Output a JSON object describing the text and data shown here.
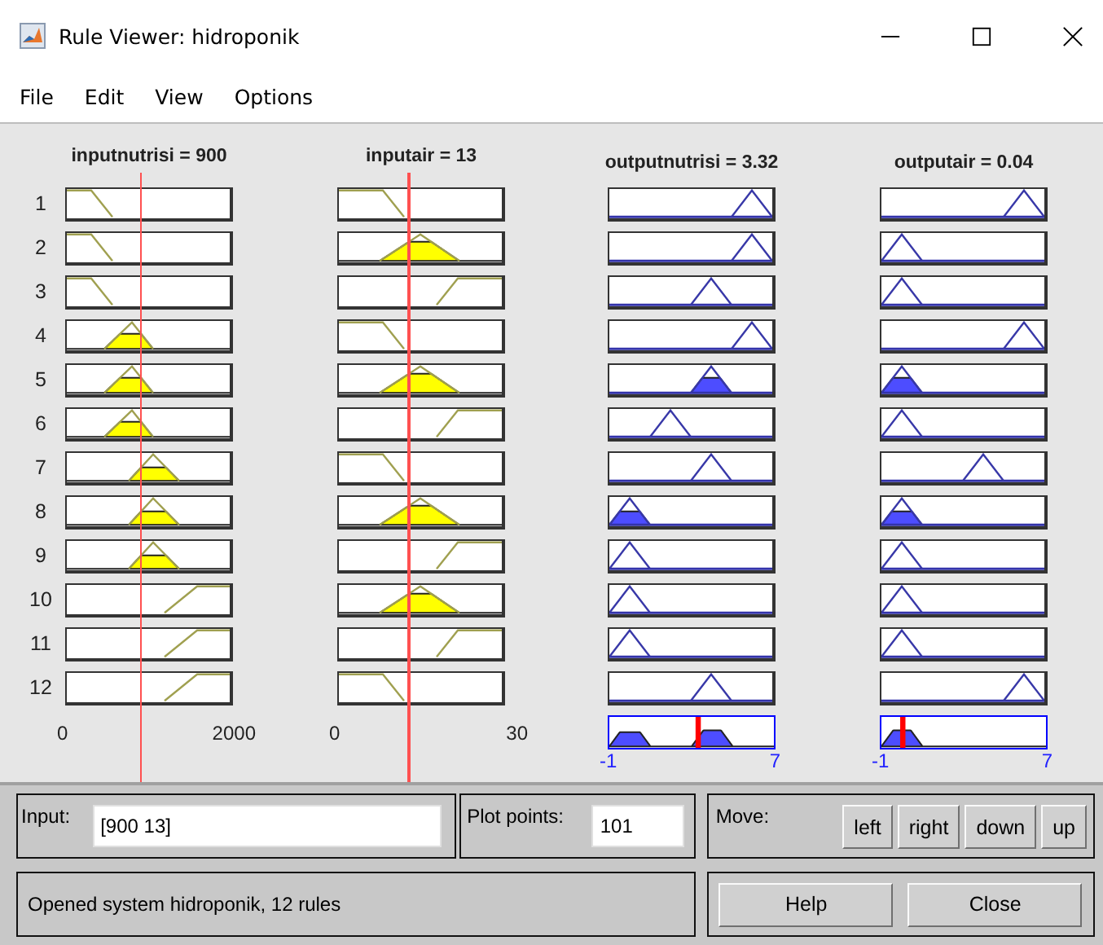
{
  "window": {
    "title": "Rule Viewer: hidroponik"
  },
  "menu": [
    "File",
    "Edit",
    "View",
    "Options"
  ],
  "variables": [
    {
      "title": "inputnutrisi = 900",
      "kind": "input",
      "axis": [
        "0",
        "2000"
      ]
    },
    {
      "title": "inputair = 13",
      "kind": "input",
      "axis": [
        "0",
        "30"
      ]
    },
    {
      "title": "outputnutrisi = 3.32",
      "kind": "output",
      "axis": [
        "-1",
        "7"
      ]
    },
    {
      "title": "outputair = 0.04",
      "kind": "output",
      "axis": [
        "-1",
        "7"
      ]
    }
  ],
  "rules": [
    {
      "label": "1",
      "cells": [
        {
          "kind": "z"
        },
        {
          "kind": "z"
        },
        {
          "kind": "high"
        },
        {
          "kind": "high"
        }
      ]
    },
    {
      "label": "2",
      "cells": [
        {
          "kind": "z"
        },
        {
          "kind": "tri"
        },
        {
          "kind": "high"
        },
        {
          "kind": "low"
        }
      ]
    },
    {
      "label": "3",
      "cells": [
        {
          "kind": "z"
        },
        {
          "kind": "s"
        },
        {
          "kind": "mid"
        },
        {
          "kind": "low"
        }
      ]
    },
    {
      "label": "4",
      "cells": [
        {
          "kind": "tri-a"
        },
        {
          "kind": "z"
        },
        {
          "kind": "high"
        },
        {
          "kind": "high"
        }
      ]
    },
    {
      "label": "5",
      "cells": [
        {
          "kind": "tri-a"
        },
        {
          "kind": "tri"
        },
        {
          "kind": "mid"
        },
        {
          "kind": "low"
        }
      ]
    },
    {
      "label": "6",
      "cells": [
        {
          "kind": "tri-a"
        },
        {
          "kind": "s"
        },
        {
          "kind": "mid-low"
        },
        {
          "kind": "low"
        }
      ]
    },
    {
      "label": "7",
      "cells": [
        {
          "kind": "tri-b"
        },
        {
          "kind": "z"
        },
        {
          "kind": "mid"
        },
        {
          "kind": "mid"
        }
      ]
    },
    {
      "label": "8",
      "cells": [
        {
          "kind": "tri-b"
        },
        {
          "kind": "tri"
        },
        {
          "kind": "low"
        },
        {
          "kind": "low"
        }
      ]
    },
    {
      "label": "9",
      "cells": [
        {
          "kind": "tri-b"
        },
        {
          "kind": "s"
        },
        {
          "kind": "low"
        },
        {
          "kind": "low"
        }
      ]
    },
    {
      "label": "10",
      "cells": [
        {
          "kind": "s"
        },
        {
          "kind": "tri"
        },
        {
          "kind": "low"
        },
        {
          "kind": "low"
        }
      ]
    },
    {
      "label": "11",
      "cells": [
        {
          "kind": "s"
        },
        {
          "kind": "s"
        },
        {
          "kind": "low"
        },
        {
          "kind": "low"
        }
      ]
    },
    {
      "label": "12",
      "cells": [
        {
          "kind": "s"
        },
        {
          "kind": "z"
        },
        {
          "kind": "mid"
        },
        {
          "kind": "high"
        }
      ]
    }
  ],
  "input": {
    "label": "Input:",
    "value": "[900 13]"
  },
  "plot_points": {
    "label": "Plot points:",
    "value": "101"
  },
  "move": {
    "label": "Move:",
    "buttons": [
      "left",
      "right",
      "down",
      "up"
    ]
  },
  "status": "Opened system hidroponik, 12 rules",
  "buttons": [
    "Help",
    "Close"
  ]
}
